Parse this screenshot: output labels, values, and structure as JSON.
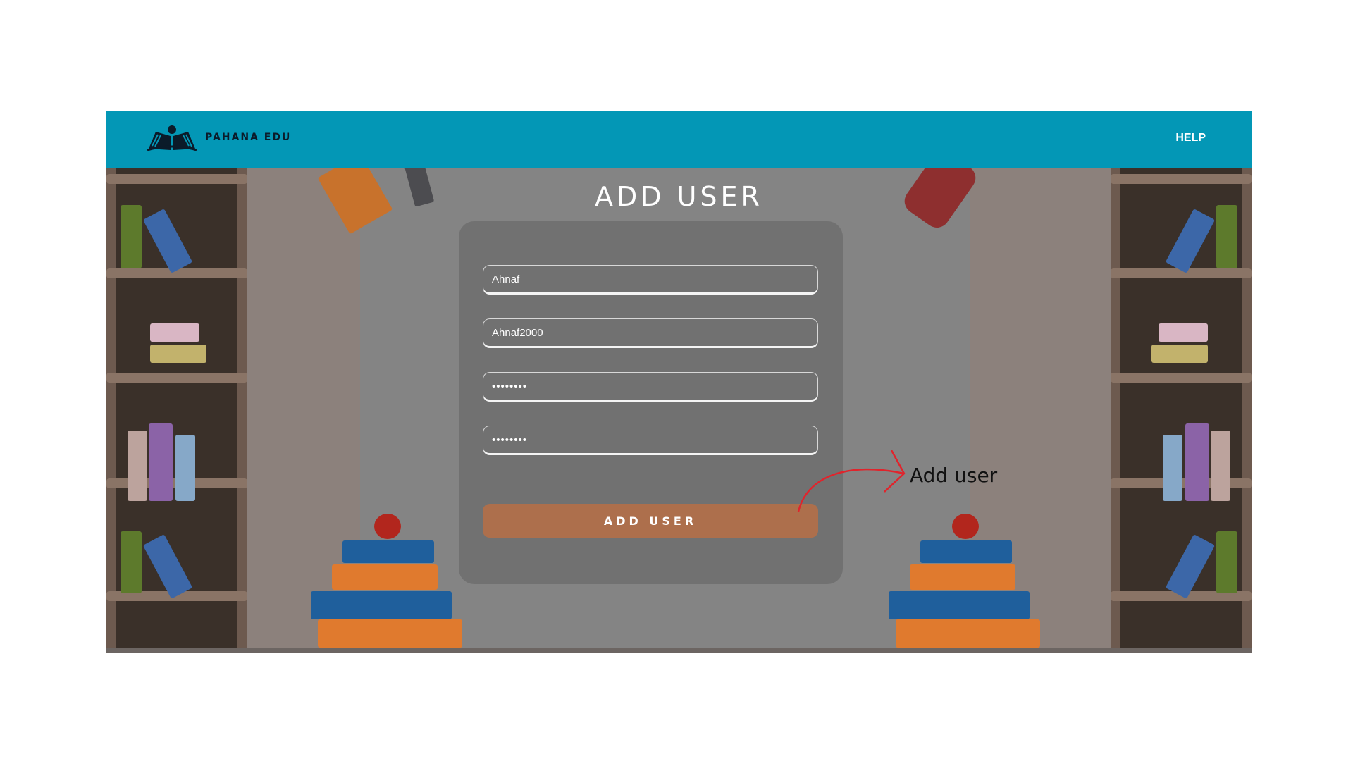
{
  "app": {
    "brand": "PAHANA EDU",
    "help_label": "HELP"
  },
  "page": {
    "title": "ADD USER"
  },
  "form": {
    "name_value": "Ahnaf",
    "username_value": "Ahnaf2000",
    "password_value": "••••••••",
    "confirm_password_value": "••••••••",
    "submit_label": "ADD USER"
  },
  "annotation": {
    "text": "Add user",
    "color": "#e0242c"
  },
  "colors": {
    "navbar": "#0397b6",
    "button": "#ad6f4c",
    "card": "#717171"
  },
  "icons": {
    "logo": "open-book-reader-icon"
  }
}
